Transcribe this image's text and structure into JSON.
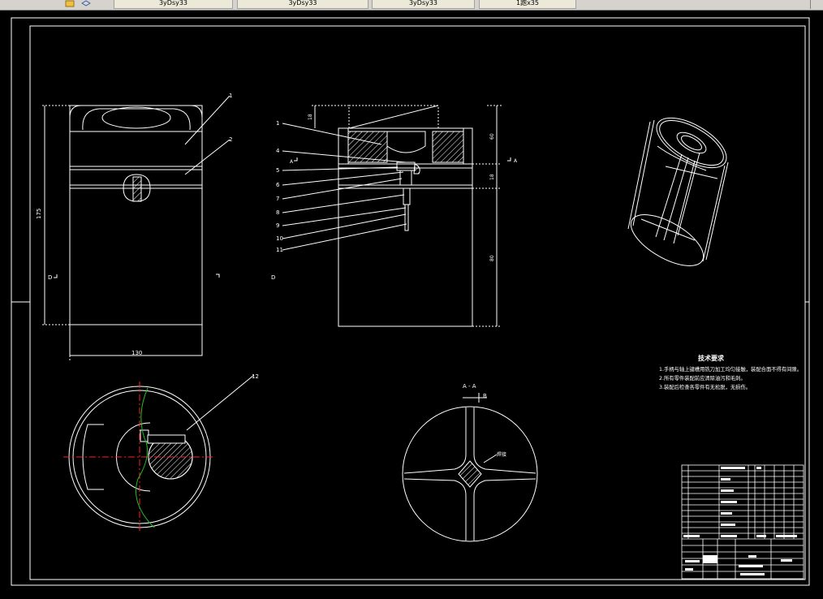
{
  "toolbar": {
    "tabs": [
      {
        "label": "3yDsy33"
      },
      {
        "label": "3yDsy33"
      },
      {
        "label": "3yDsy33"
      },
      {
        "label": "1跑x35"
      }
    ]
  },
  "drawing": {
    "front_view": {
      "callouts": [
        "1",
        "2"
      ],
      "dim_height": "175",
      "dim_width": "130",
      "section_marker": "D"
    },
    "section_view": {
      "callouts": [
        "1",
        "4",
        "5",
        "6",
        "7",
        "8",
        "9",
        "10",
        "11"
      ],
      "dim_top": "18",
      "dim_upper": "60",
      "dim_mid": "18",
      "dim_lower": "80",
      "section_marker": "A"
    },
    "bottom_view": {
      "callout": "12"
    },
    "section_a": {
      "title": "A - A",
      "label": "B",
      "note": "焊接"
    },
    "notes": {
      "title": "技术要求",
      "lines": [
        "1.手柄与轴上键槽用铣刀加工均匀接触，装配合面不得有间隙。",
        "2.所有零件装配前应清除油污和毛刺。",
        "3.装配后检查各零件有无松脱，无损伤。"
      ]
    }
  }
}
